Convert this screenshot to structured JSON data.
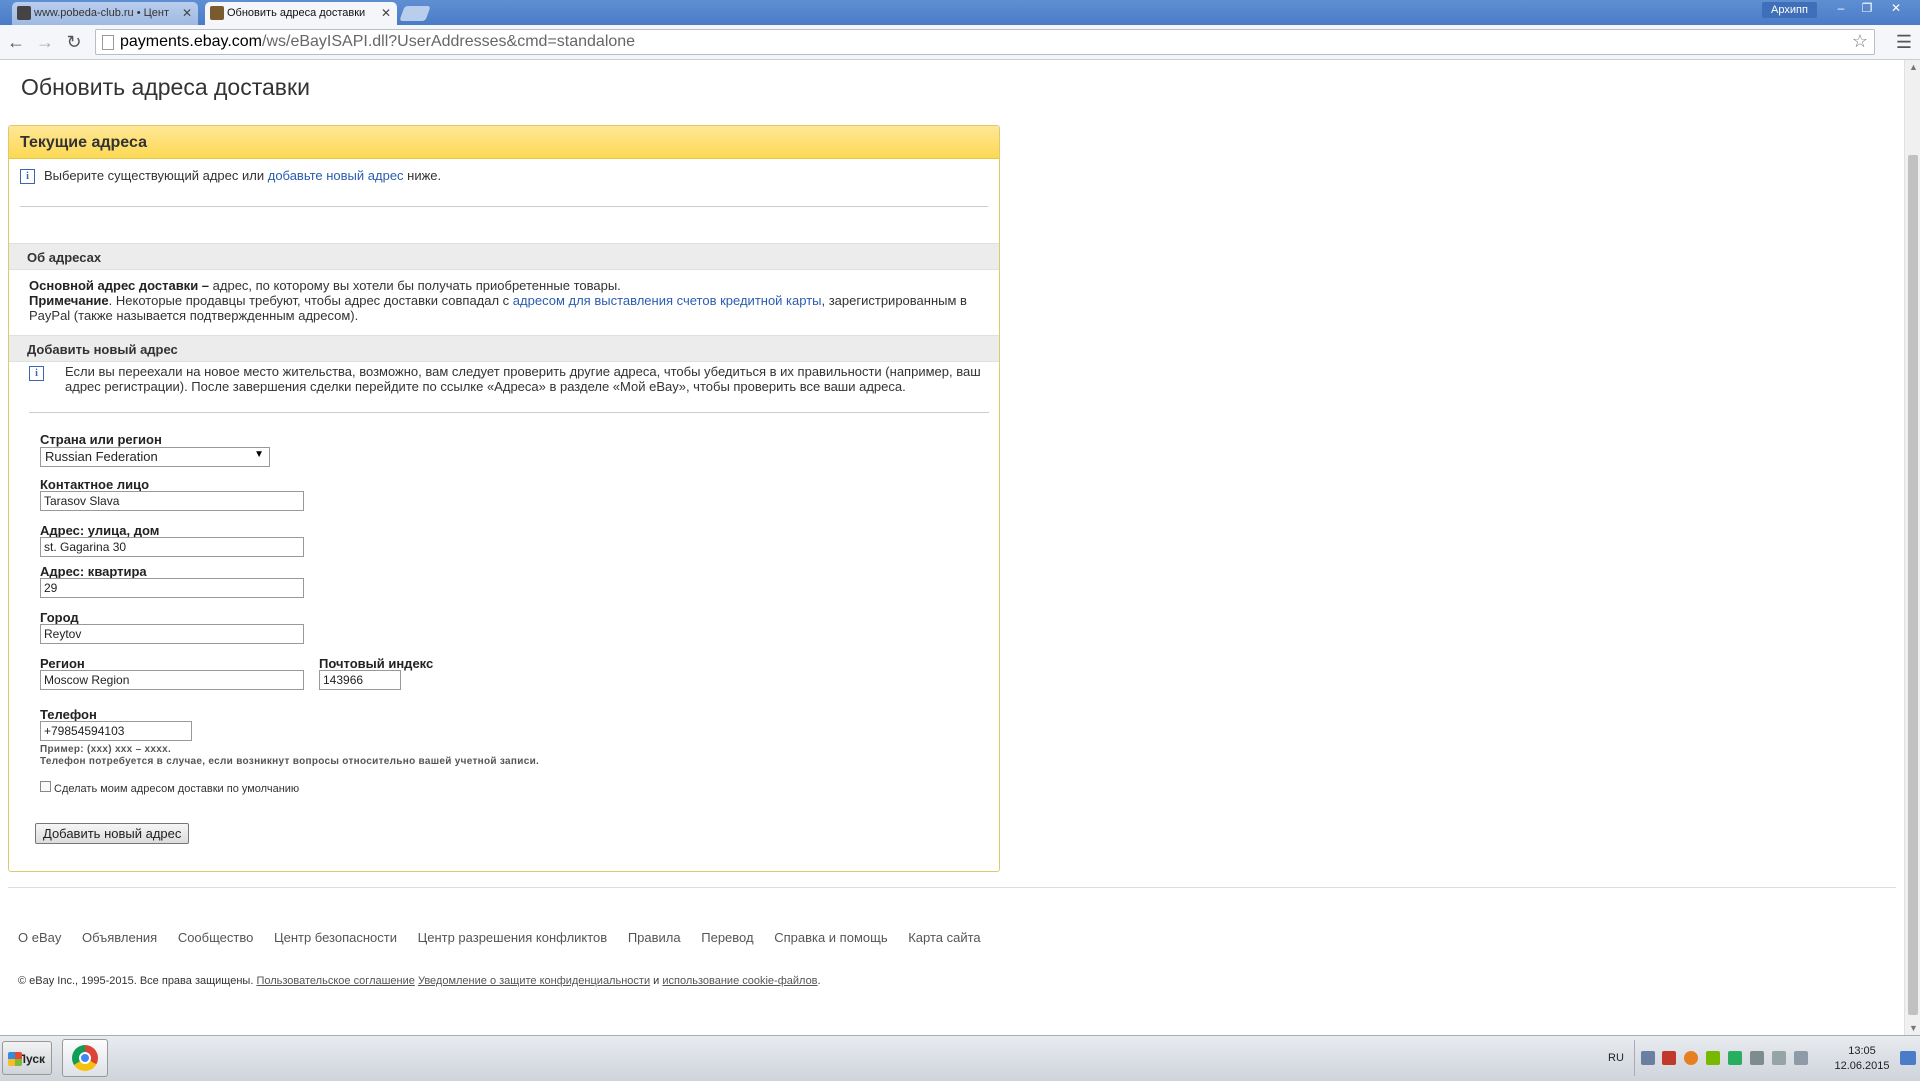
{
  "browser": {
    "tabs": [
      {
        "label": "www.pobeda-club.ru • Цент"
      },
      {
        "label": "Обновить адреса доставки"
      }
    ],
    "user_label": "Архипп",
    "window_controls": [
      "–",
      "❐",
      "✕"
    ],
    "url_host": "payments.ebay.com",
    "url_path": "/ws/eBayISAPI.dll?UserAddresses&cmd=standalone"
  },
  "page": {
    "title": "Обновить адреса доставки",
    "current_panel": {
      "title": "Текущие адреса",
      "info_prefix": "Выберите существующий адрес или ",
      "info_link": "добавьте новый адрес",
      "info_suffix": " ниже."
    },
    "about": {
      "title": "Об адресах",
      "primary_bold": "Основной адрес доставки –",
      "primary_text": " адрес, по которому вы хотели бы получать приобретенные товары.",
      "note_bold": "Примечание",
      "note_text": ". Некоторые продавцы требуют, чтобы адрес доставки совпадал с ",
      "note_link": "адресом для выставления счетов кредитной карты",
      "note_text2": ", зарегистрированным в PayPal (также называется подтвержденным адресом)."
    },
    "add": {
      "title": "Добавить новый адрес",
      "info_text": "Если вы переехали на новое место жительства, возможно, вам следует проверить другие адреса, чтобы убедиться в их правильности (например, ваш адрес регистрации). После завершения сделки перейдите по ссылке «Адреса» в разделе «Мой eBay», чтобы проверить все ваши адреса."
    },
    "form": {
      "country_label": "Страна или регион",
      "country_value": "Russian Federation",
      "contact_label": "Контактное лицо",
      "contact_value": "Tarasov Slava",
      "street_label": "Адрес: улица, дом",
      "street_value": "st. Gagarina 30",
      "apt_label": "Адрес: квартира",
      "apt_value": "29",
      "city_label": "Город",
      "city_value": "Reytov",
      "region_label": "Регион",
      "region_value": "Moscow Region",
      "zip_label": "Почтовый индекс",
      "zip_value": "143966",
      "phone_label": "Телефон",
      "phone_value": "+79854594103",
      "phone_hint1": "Пример: (xxx) xxx – xxxx.",
      "phone_hint2": "Телефон потребуется в случае, если возникнут вопросы относительно вашей учетной записи.",
      "default_checkbox_label": "Сделать моим адресом доставки по умолчанию",
      "submit_label": "Добавить новый адрес"
    },
    "footer": {
      "links": [
        "О eBay",
        "Объявления",
        "Сообщество",
        "Центр безопасности",
        "Центр разрешения конфликтов",
        "Правила",
        "Перевод",
        "Справка и помощь",
        "Карта сайта"
      ],
      "copyright_prefix": "© eBay Inc., 1995-2015. Все права защищены. ",
      "user_agreement": "Пользовательское соглашение",
      "privacy": "Уведомление о защите конфиденциальности",
      "and": " и ",
      "cookies": "использование cookie-файлов",
      "end": "."
    }
  },
  "taskbar": {
    "start_label": "Пуск",
    "lang": "RU",
    "time": "13:05",
    "date": "12.06.2015"
  },
  "colors": {
    "panel_header": "#fcd954",
    "link": "#2a5db0",
    "titlebar": "#4a7cc7"
  }
}
